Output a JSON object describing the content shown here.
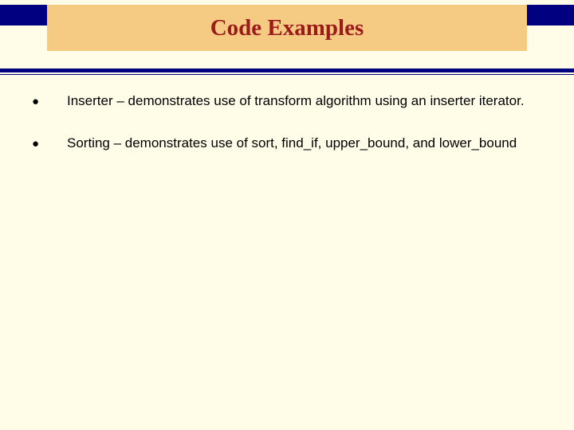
{
  "title": "Code Examples",
  "bullets": [
    {
      "text": "Inserter – demonstrates use of transform algorithm using an inserter iterator."
    },
    {
      "text": "Sorting – demonstrates use of sort, find_if, upper_bound, and lower_bound"
    }
  ]
}
